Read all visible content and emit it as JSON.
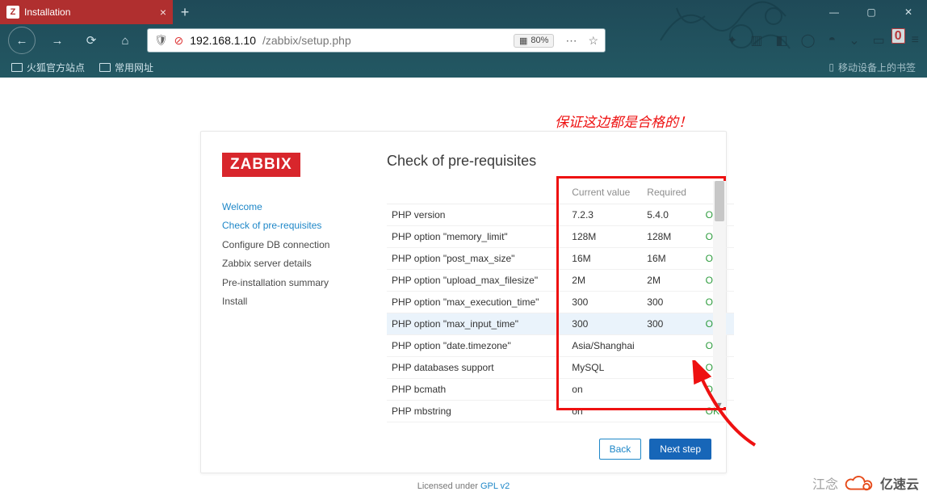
{
  "browser": {
    "tab_title": "Installation",
    "tab_favicon_letter": "Z",
    "url_host": "192.168.1.10",
    "url_path": "/zabbix/setup.php",
    "zoom": "80%",
    "bookmarks": {
      "b1": "火狐官方站点",
      "b2": "常用网址",
      "right": "移动设备上的书签"
    },
    "notif_badge": "0"
  },
  "annotation": "保证这边都是合格的！",
  "logo": "ZABBIX",
  "title": "Check of pre-requisites",
  "steps": {
    "s1": "Welcome",
    "s2": "Check of pre-requisites",
    "s3": "Configure DB connection",
    "s4": "Zabbix server details",
    "s5": "Pre-installation summary",
    "s6": "Install"
  },
  "table": {
    "h_current": "Current value",
    "h_required": "Required",
    "rows": [
      {
        "name": "PHP version",
        "cur": "7.2.3",
        "req": "5.4.0",
        "status": "OK"
      },
      {
        "name": "PHP option \"memory_limit\"",
        "cur": "128M",
        "req": "128M",
        "status": "OK"
      },
      {
        "name": "PHP option \"post_max_size\"",
        "cur": "16M",
        "req": "16M",
        "status": "OK"
      },
      {
        "name": "PHP option \"upload_max_filesize\"",
        "cur": "2M",
        "req": "2M",
        "status": "OK"
      },
      {
        "name": "PHP option \"max_execution_time\"",
        "cur": "300",
        "req": "300",
        "status": "OK"
      },
      {
        "name": "PHP option \"max_input_time\"",
        "cur": "300",
        "req": "300",
        "status": "OK"
      },
      {
        "name": "PHP option \"date.timezone\"",
        "cur": "Asia/Shanghai",
        "req": "",
        "status": "OK"
      },
      {
        "name": "PHP databases support",
        "cur": "MySQL",
        "req": "",
        "status": "OK"
      },
      {
        "name": "PHP bcmath",
        "cur": "on",
        "req": "",
        "status": "OK"
      },
      {
        "name": "PHP mbstring",
        "cur": "on",
        "req": "",
        "status": "OK"
      }
    ]
  },
  "buttons": {
    "back": "Back",
    "next": "Next step"
  },
  "license": {
    "prefix": "Licensed under ",
    "link": "GPL v2"
  },
  "watermark": {
    "text1": "江念",
    "text2": "亿速云"
  }
}
